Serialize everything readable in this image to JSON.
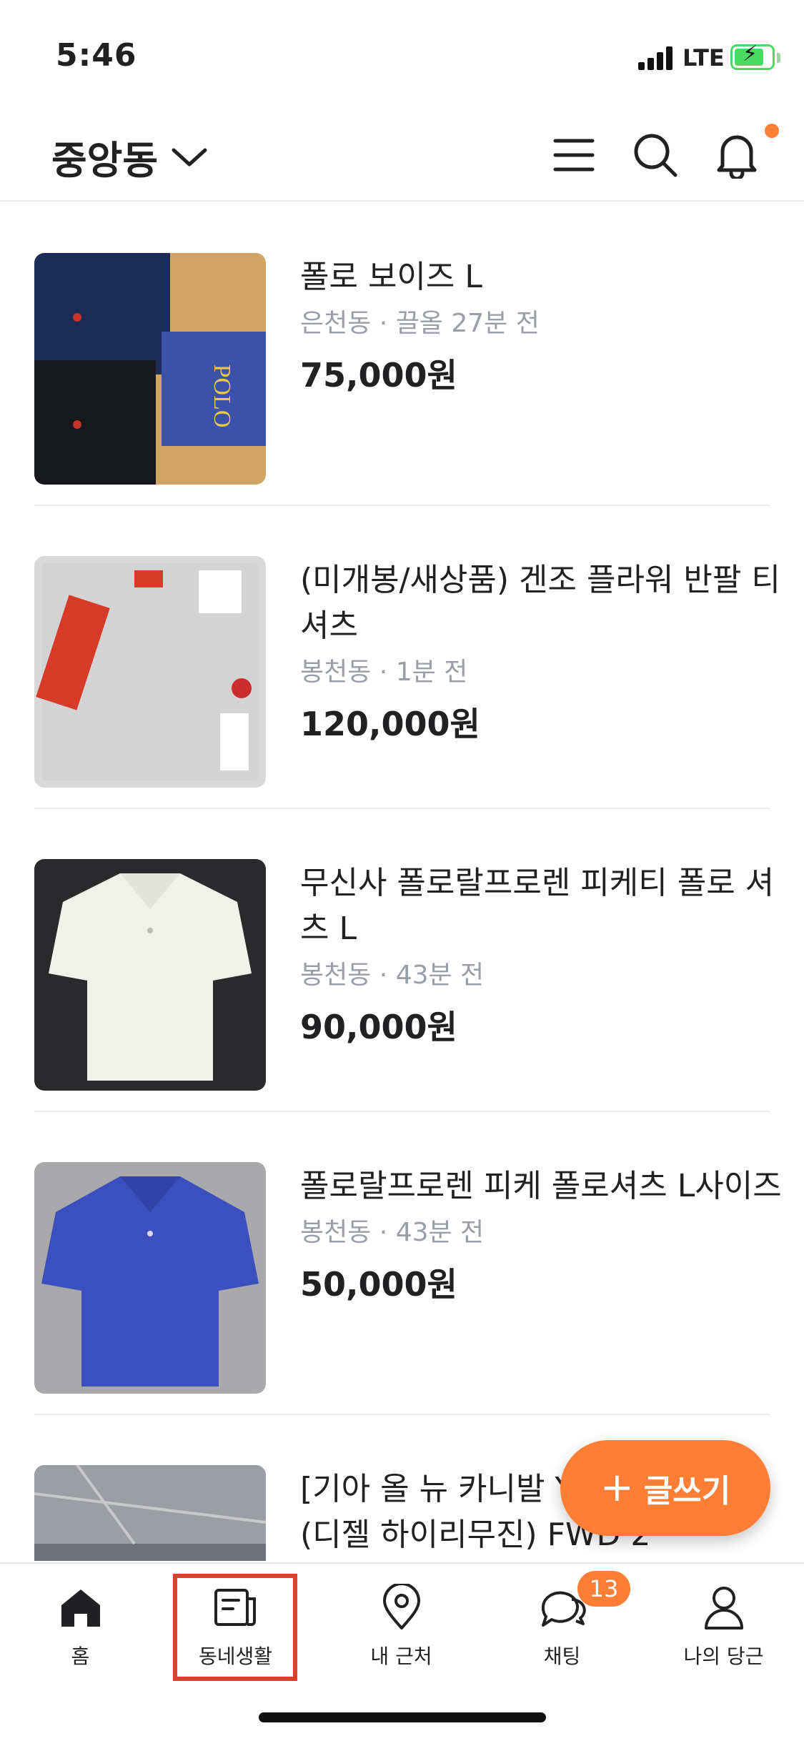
{
  "status_bar": {
    "time": "5:46",
    "network": "LTE"
  },
  "header": {
    "location": "중앙동"
  },
  "items": [
    {
      "title": "폴로 보이즈 L",
      "meta": "은천동 · 끌올 27분 전",
      "price": "75,000원"
    },
    {
      "title": "(미개봉/새상품) 겐조 플라워 반팔 티셔츠",
      "meta": "봉천동 · 1분 전",
      "price": "120,000원"
    },
    {
      "title": "무신사 폴로랄프로렌 피케티 폴로 셔츠 L",
      "meta": "봉천동 · 43분 전",
      "price": "90,000원"
    },
    {
      "title": "폴로랄프로렌 피케 폴로셔츠 L사이즈",
      "meta": "봉천동 · 43분 전",
      "price": "50,000원"
    },
    {
      "title": "[기아 올 뉴 카니발 Y",
      "title2": "(디젤 하이리무진) FWD 2",
      "meta": "",
      "price": ""
    }
  ],
  "fab": {
    "plus": "+",
    "label": "글쓰기"
  },
  "tabs": [
    {
      "label": "홈",
      "icon": "home-icon"
    },
    {
      "label": "동네생활",
      "icon": "community-icon"
    },
    {
      "label": "내 근처",
      "icon": "location-pin-icon"
    },
    {
      "label": "채팅",
      "icon": "chat-icon"
    },
    {
      "label": "나의 당근",
      "icon": "person-icon"
    }
  ],
  "chat_badge": "13",
  "colors": {
    "accent": "#ff7e36",
    "highlight": "#e53b2c",
    "muted": "#9a9ea6"
  }
}
